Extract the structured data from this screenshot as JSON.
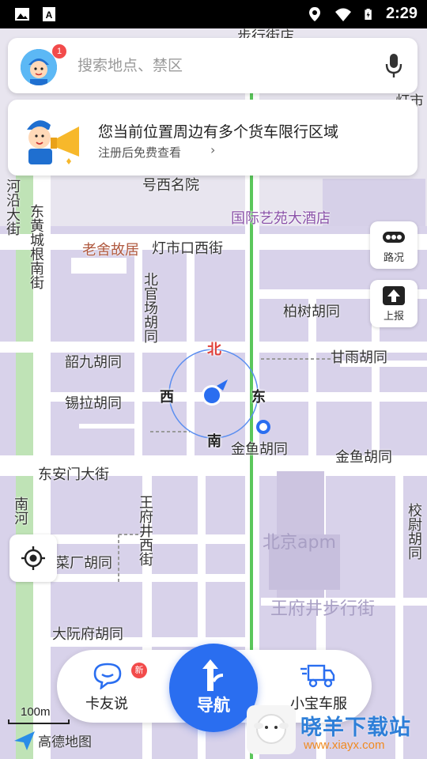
{
  "status_bar": {
    "time": "2:29",
    "icons": [
      "gallery-icon",
      "a-text-icon",
      "location-icon",
      "wifi-icon",
      "battery-charging-icon"
    ]
  },
  "search": {
    "placeholder": "搜索地点、禁区",
    "avatar_badge": "1"
  },
  "notice": {
    "title": "您当前位置周边有多个货车限行区域",
    "subtitle": "注册后免费查看",
    "arrow": "›"
  },
  "side_buttons": [
    {
      "label": "路况",
      "icon": "traffic-icon"
    },
    {
      "label": "上报",
      "icon": "report-icon"
    }
  ],
  "compass": {
    "north": "北",
    "south": "南",
    "east": "东",
    "west": "西"
  },
  "map_labels": {
    "top_partial": "步行街店",
    "hotel_partial": "号西名院",
    "guoji": "国际艺苑大酒店",
    "laoshe": "老舍故居",
    "dengshi": "灯市口西街",
    "donghuang": "东黄城根南街",
    "hehe": "河沿大街",
    "beiguan": "北官场胡同",
    "baishu": "柏树胡同",
    "ganyu": "甘雨胡同",
    "shaojiu": "韶九胡同",
    "xila": "锡拉胡同",
    "jinyu1": "金鱼胡同",
    "jinyu2": "金鱼胡同",
    "donganmen": "东安门大街",
    "wangfujing_v": "王府井西街",
    "jiaochang": "校尉胡同",
    "beijing_apm": "北京apm",
    "wangfujing_walk": "王府井步行街",
    "caichang": "菜厂胡同",
    "dayuanfu": "大阮府胡同",
    "nanhe": "南河",
    "dengshi_right": "灯市"
  },
  "bottom_bar": {
    "left_label": "卡友说",
    "left_badge": "新",
    "center_label": "导航",
    "right_label": "小宝车服"
  },
  "scale": "100m",
  "logo_text": "高德地图",
  "watermark": {
    "title": "晓羊下载站",
    "url": "www.xiayx.com"
  },
  "colors": {
    "map_bg": "#d8d2ea",
    "road": "#ffffff",
    "green_line": "#5bc75b",
    "nav_blue": "#2a6ef0",
    "north_red": "#e0403a"
  }
}
